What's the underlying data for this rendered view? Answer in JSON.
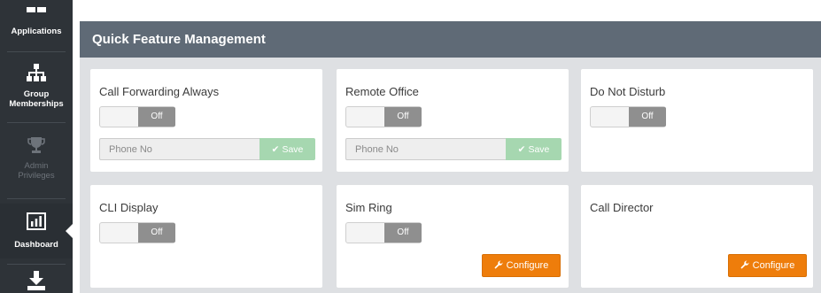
{
  "sidebar": {
    "items": [
      {
        "label": "Applications",
        "icon": "grid-icon"
      },
      {
        "label": "Group Memberships",
        "icon": "org-chart-icon"
      },
      {
        "label": "Admin Privileges",
        "icon": "trophy-icon"
      },
      {
        "label": "Dashboard",
        "icon": "bar-chart-icon"
      },
      {
        "label": "",
        "icon": "download-icon"
      }
    ]
  },
  "panel": {
    "title": "Quick Feature Management"
  },
  "cards": {
    "call_forwarding_always": {
      "title": "Call Forwarding Always",
      "toggle_label": "Off",
      "phone_placeholder": "Phone No",
      "save_label": "Save"
    },
    "remote_office": {
      "title": "Remote Office",
      "toggle_label": "Off",
      "phone_placeholder": "Phone No",
      "save_label": "Save"
    },
    "do_not_disturb": {
      "title": "Do Not Disturb",
      "toggle_label": "Off"
    },
    "cli_display": {
      "title": "CLI Display",
      "toggle_label": "Off"
    },
    "sim_ring": {
      "title": "Sim Ring",
      "toggle_label": "Off",
      "configure_label": "Configure"
    },
    "call_director": {
      "title": "Call Director",
      "configure_label": "Configure"
    }
  },
  "colors": {
    "sidebar_bg": "#2e3338",
    "header_bg": "#5f6a76",
    "save_green": "#a6d7b0",
    "configure_orange": "#ee7d0b",
    "toggle_off": "#8f8f8f"
  }
}
